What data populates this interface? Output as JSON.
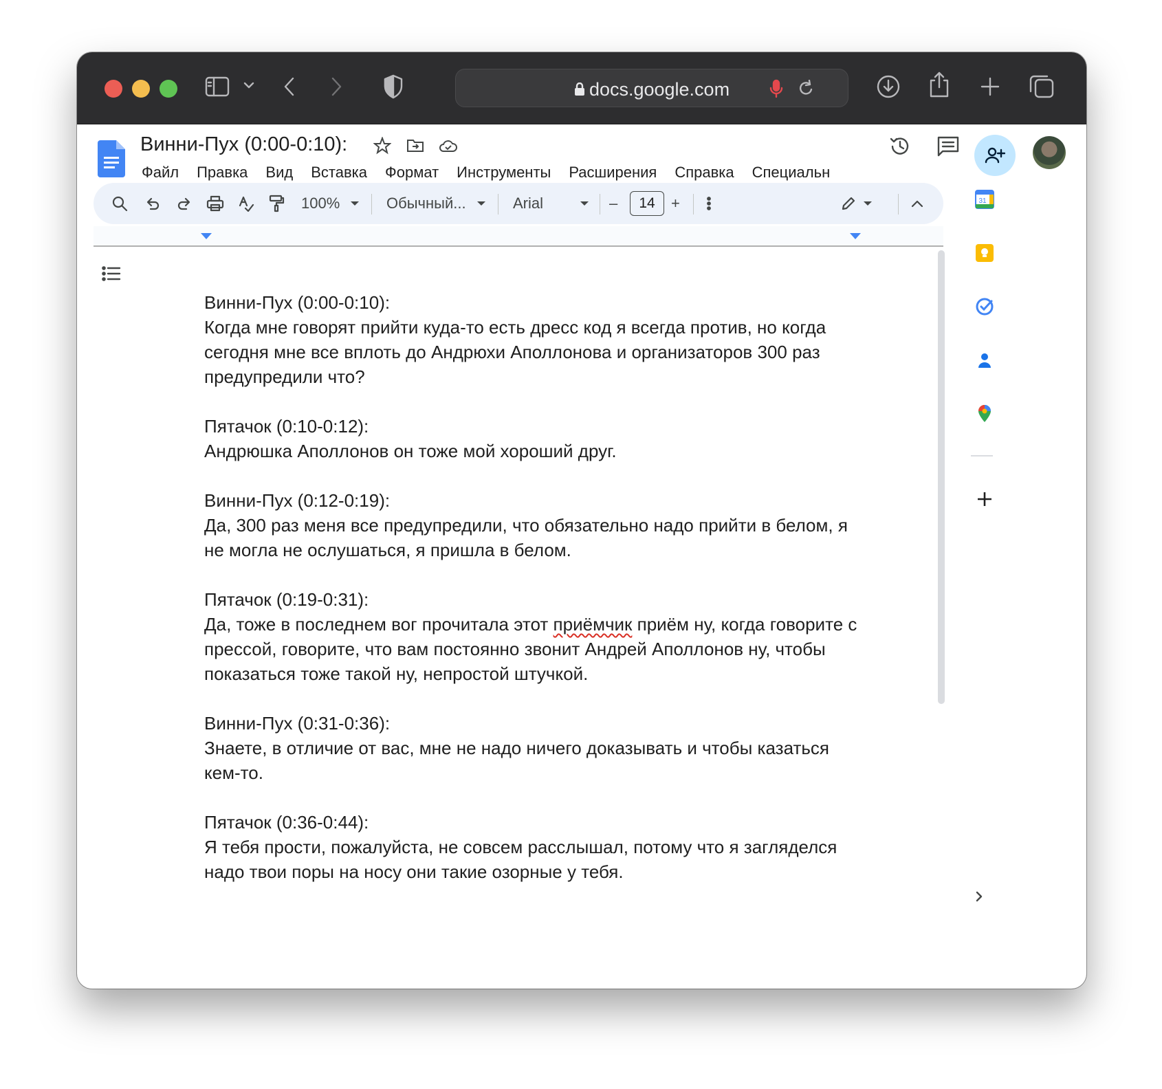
{
  "browser": {
    "url": "docs.google.com"
  },
  "doc": {
    "title": "Винни-Пух (0:00-0:10):",
    "menu": [
      "Файл",
      "Правка",
      "Вид",
      "Вставка",
      "Формат",
      "Инструменты",
      "Расширения",
      "Справка",
      "Специальн"
    ]
  },
  "toolbar": {
    "zoom": "100%",
    "style": "Обычный...",
    "font": "Arial",
    "font_size": "14",
    "minus": "–",
    "plus": "+"
  },
  "content": {
    "paragraphs": [
      {
        "speaker": "Винни-Пух (0:00-0:10):",
        "text": "Когда мне говорят прийти куда-то есть дресс код я всегда против, но когда сегодня мне все вплоть до Андрюхи Аполлонова и организаторов 300 раз предупредили что?"
      },
      {
        "speaker": "Пятачок (0:10-0:12):",
        "text": "Андрюшка Аполлонов он тоже мой хороший друг."
      },
      {
        "speaker": "Винни-Пух (0:12-0:19):",
        "text": "Да, 300 раз меня все предупредили, что обязательно надо прийти в белом, я не могла не ослушаться, я пришла в белом."
      },
      {
        "speaker": "Пятачок (0:19-0:31):",
        "text_before": "Да, тоже в последнем вог прочитала этот ",
        "text_misspelled": "приёмчик",
        "text_after": " приём ну, когда говорите с прессой, говорите, что вам постоянно звонит Андрей Аполлонов ну, чтобы показаться тоже такой ну, непростой штучкой."
      },
      {
        "speaker": "Винни-Пух (0:31-0:36):",
        "text": "Знаете, в отличие от вас, мне не надо ничего доказывать и чтобы казаться кем-то."
      },
      {
        "speaker": "Пятачок (0:36-0:44):",
        "text": "Я тебя прости, пожалуйста, не совсем расслышал, потому что я загляделся надо твои поры на носу они такие озорные у тебя."
      }
    ]
  },
  "colors": {
    "accent": "#4285f4",
    "share_bg": "#c2e7ff",
    "titlebar": "#2d2d2f"
  }
}
